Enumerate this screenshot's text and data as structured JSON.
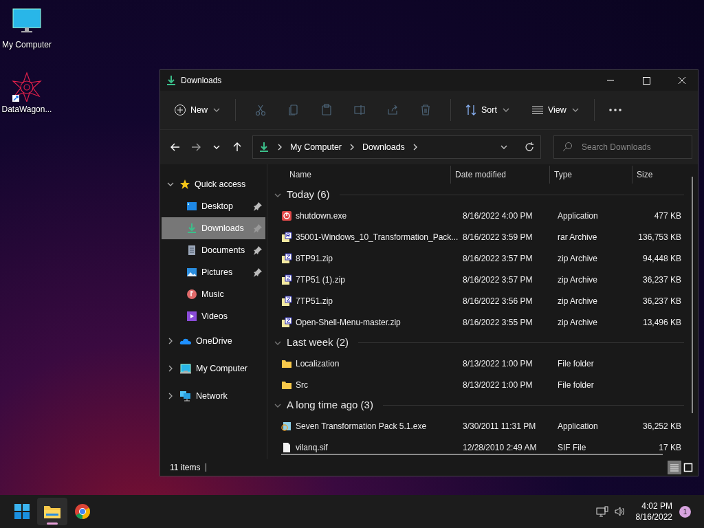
{
  "desktop_icons": [
    {
      "label": "My Computer",
      "kind": "monitor"
    },
    {
      "label": "DataWagon...",
      "kind": "shortcut"
    }
  ],
  "window": {
    "title": "Downloads"
  },
  "toolbar": {
    "new": "New",
    "tools": [
      {
        "kind": "cut",
        "disabled": true
      },
      {
        "kind": "copy",
        "disabled": true
      },
      {
        "kind": "paste",
        "disabled": true
      },
      {
        "kind": "rename",
        "disabled": true
      },
      {
        "kind": "share",
        "disabled": true
      },
      {
        "kind": "delete",
        "disabled": true
      }
    ],
    "sort": "Sort",
    "view": "View"
  },
  "address": {
    "crumbs": [
      "My Computer",
      "Downloads"
    ],
    "search_placeholder": "Search Downloads"
  },
  "sidebar": {
    "items": [
      {
        "label": "Quick access",
        "kind": "star",
        "expanded": true,
        "children": [
          {
            "label": "Desktop",
            "kind": "desktop",
            "pinned": true,
            "selected": false
          },
          {
            "label": "Downloads",
            "kind": "download",
            "pinned": true,
            "selected": true
          },
          {
            "label": "Documents",
            "kind": "document",
            "pinned": true,
            "selected": false
          },
          {
            "label": "Pictures",
            "kind": "picture",
            "pinned": true,
            "selected": false
          },
          {
            "label": "Music",
            "kind": "music",
            "pinned": false,
            "selected": false
          },
          {
            "label": "Videos",
            "kind": "video",
            "pinned": false,
            "selected": false
          }
        ]
      },
      {
        "label": "OneDrive",
        "kind": "cloud",
        "expanded": false
      },
      {
        "label": "My Computer",
        "kind": "monitor",
        "expanded": false
      },
      {
        "label": "Network",
        "kind": "network",
        "expanded": false
      }
    ]
  },
  "table": {
    "columns": [
      "Name",
      "Date modified",
      "Type",
      "Size"
    ],
    "groups": [
      {
        "title": "Today (6)",
        "expanded": true,
        "rows": [
          {
            "name": "shutdown.exe",
            "date": "8/16/2022 4:00 PM",
            "type": "Application",
            "size": "477 KB",
            "kind": "power"
          },
          {
            "name": "35001-Windows_10_Transformation_Pack...",
            "date": "8/16/2022 3:59 PM",
            "type": "rar Archive",
            "size": "136,753 KB",
            "kind": "rar"
          },
          {
            "name": "8TP91.zip",
            "date": "8/16/2022 3:57 PM",
            "type": "zip Archive",
            "size": "94,448 KB",
            "kind": "zip"
          },
          {
            "name": "7TP51 (1).zip",
            "date": "8/16/2022 3:57 PM",
            "type": "zip Archive",
            "size": "36,237 KB",
            "kind": "zip"
          },
          {
            "name": "7TP51.zip",
            "date": "8/16/2022 3:56 PM",
            "type": "zip Archive",
            "size": "36,237 KB",
            "kind": "zip"
          },
          {
            "name": "Open-Shell-Menu-master.zip",
            "date": "8/16/2022 3:55 PM",
            "type": "zip Archive",
            "size": "13,496 KB",
            "kind": "zip"
          }
        ]
      },
      {
        "title": "Last week (2)",
        "expanded": true,
        "rows": [
          {
            "name": "Localization",
            "date": "8/13/2022 1:00 PM",
            "type": "File folder",
            "kind": "folder"
          },
          {
            "name": "Src",
            "date": "8/13/2022 1:00 PM",
            "type": "File folder",
            "kind": "folder"
          }
        ]
      },
      {
        "title": "A long time ago (3)",
        "expanded": true,
        "rows": [
          {
            "name": "Seven Transformation Pack 5.1.exe",
            "date": "3/30/2011 11:31 PM",
            "type": "Application",
            "size": "36,252 KB",
            "kind": "setup"
          },
          {
            "name": "vilanq.sif",
            "date": "12/28/2010 2:49 AM",
            "type": "SIF File",
            "size": "17 KB",
            "kind": "file"
          }
        ]
      }
    ]
  },
  "status_bar": {
    "count": "11 items",
    "views": [
      {
        "kind": "details",
        "selected": true
      },
      {
        "kind": "tiles",
        "selected": false
      }
    ]
  },
  "taskbar": {
    "apps": [
      {
        "kind": "start",
        "running": false
      },
      {
        "kind": "explorer",
        "running": true
      },
      {
        "kind": "browser",
        "running": false
      }
    ],
    "time": "4:02 PM",
    "date": "8/16/2022",
    "badge": "1"
  }
}
